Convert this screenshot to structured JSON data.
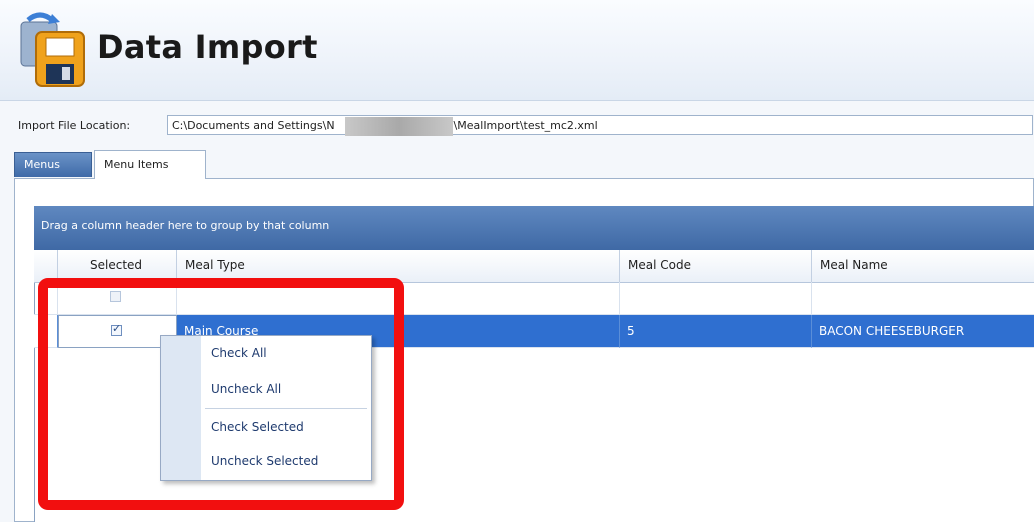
{
  "window": {
    "title": "Data Import",
    "icon": "data-import-floppy-icon"
  },
  "import": {
    "label": "Import File Location:",
    "value": "C:\\Documents and Settings\\N                    \\Desktop\\MealImport\\test_mc2.xml"
  },
  "tabs": [
    {
      "label": "Menus",
      "active": false
    },
    {
      "label": "Menu Items",
      "active": true
    }
  ],
  "grid": {
    "group_panel_text": "Drag a column header here to group by that column",
    "columns": [
      "Selected",
      "Meal Type",
      "Meal Code",
      "Meal Name"
    ],
    "new_row": {
      "selected": false,
      "meal_type": "",
      "meal_code": "",
      "meal_name": ""
    },
    "rows": [
      {
        "selected": true,
        "meal_type": "Main Course",
        "meal_code": "5",
        "meal_name": "BACON CHEESEBURGER"
      }
    ]
  },
  "context_menu": {
    "items": [
      "Check All",
      "Uncheck All",
      "Check Selected",
      "Uncheck Selected"
    ]
  },
  "colors": {
    "accent": "#3f69a5",
    "selection": "#2f6fd0",
    "highlight": "#f20f0f"
  }
}
